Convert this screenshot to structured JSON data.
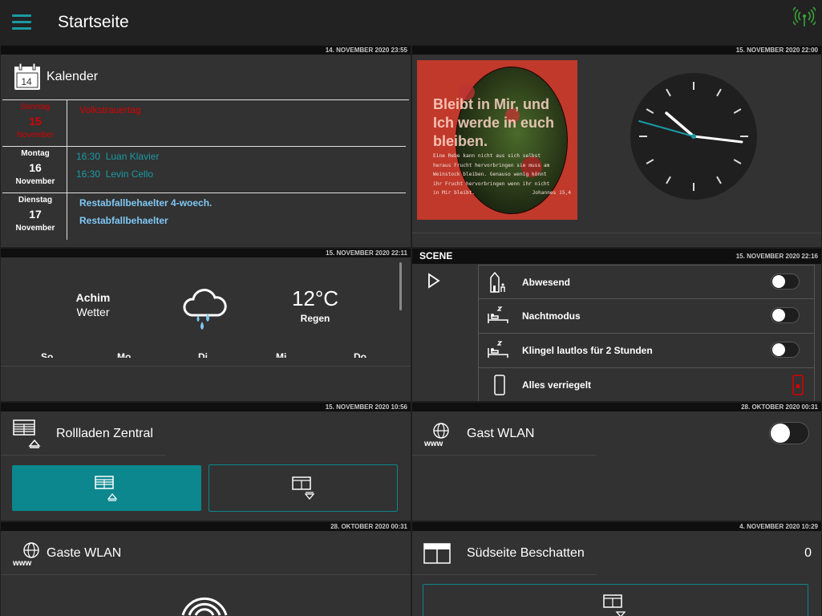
{
  "header": {
    "title": "Startseite"
  },
  "calendar": {
    "stamp": "14. NOVEMBER 2020 23:55",
    "title": "Kalender",
    "days": [
      {
        "weekday": "Sonntag",
        "day": "15",
        "month": "November",
        "events": [
          "Volkstrauertag"
        ]
      },
      {
        "weekday": "Montag",
        "day": "16",
        "month": "November",
        "events": [
          "16:30  Luan Klavier",
          "16:30  Levin Cello"
        ]
      },
      {
        "weekday": "Dienstag",
        "day": "17",
        "month": "November",
        "events": [
          "Restabfallbehaelter 4-woech.",
          "Restabfallbehaelter"
        ]
      }
    ]
  },
  "photo": {
    "stamp": "15. NOVEMBER 2020 22:00",
    "verse_title": "Bleibt in Mir, und Ich werde in euch bleiben.",
    "verse_lines": [
      "Eine Rebe kann nicht aus sich selbst",
      "heraus Frucht hervorbringen sie muss am",
      "Weinstock bleiben. Genauso wenig könnt",
      "ihr Frucht hervorbringen wenn ihr nicht",
      "in Mir bleibt."
    ],
    "verse_ref": "Johannes 15,4"
  },
  "weather": {
    "stamp": "15. NOVEMBER 2020 22:11",
    "location": "Achim",
    "location_sub": "Wetter",
    "temp": "12°C",
    "cond": "Regen",
    "forecast_days": [
      "So",
      "Mo",
      "Di",
      "Mi",
      "Do"
    ]
  },
  "scene": {
    "stamp": "15. NOVEMBER 2020 22:16",
    "title": "SCENE",
    "items": [
      {
        "label": "Abwesend",
        "icon": "house-person-icon"
      },
      {
        "label": "Nachtmodus",
        "icon": "sleep-icon"
      },
      {
        "label": "Klingel lautlos für 2 Stunden",
        "icon": "sleep-icon"
      },
      {
        "label": "Alles verriegelt",
        "icon": "phone-icon"
      }
    ]
  },
  "shutter": {
    "stamp": "15. NOVEMBER 2020 10:56",
    "title": "Rollladen Zentral"
  },
  "guest_wlan": {
    "stamp": "28. OKTOBER 2020 00:31",
    "title": "Gast WLAN"
  },
  "guest_wlan2": {
    "stamp": "28. OKTOBER 2020 00:31",
    "title": "Gaste WLAN"
  },
  "south_shade": {
    "stamp": "4. NOVEMBER 2020 10:29",
    "title": "Südseite Beschatten",
    "value": "0"
  },
  "colors": {
    "accent": "#1a9aa3",
    "red": "#d80000",
    "blue": "#7fc8f5",
    "tile": "#323232"
  }
}
